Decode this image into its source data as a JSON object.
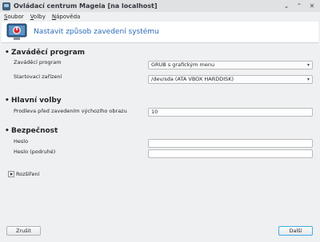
{
  "window": {
    "title": "Ovládací centrum Mageia  [na localhost]",
    "buttons": [
      "⌄",
      "⌃",
      "✕"
    ]
  },
  "menu": [
    "Soubor",
    "Volby",
    "Nápověda"
  ],
  "banner": {
    "title": "Nastavit způsob zavedení systému",
    "icon": "boot-setup-icon"
  },
  "sections": {
    "bootloader": {
      "title": "Zaváděcí program",
      "loader_label": "Zaváděcí program",
      "loader_value": "GRUB s grafickým menu",
      "device_label": "Startovací zařízení",
      "device_value": "/dev/sda (ATA VBOX HARDDISK)"
    },
    "main": {
      "title": "Hlavní volby",
      "delay_label": "Prodleva před zavedením výchozího obrazu",
      "delay_value": "10"
    },
    "security": {
      "title": "Bezpečnost",
      "password_label": "Heslo",
      "password_value": "",
      "password2_label": "Heslo (podruhé)",
      "password2_value": ""
    }
  },
  "advanced": {
    "label": "Rozšíření"
  },
  "footer": {
    "cancel": "Zrušit",
    "next": "Další"
  },
  "colors": {
    "accent": "#2b6bb8",
    "background": "#eff0f1",
    "focus": "#3daee9"
  }
}
